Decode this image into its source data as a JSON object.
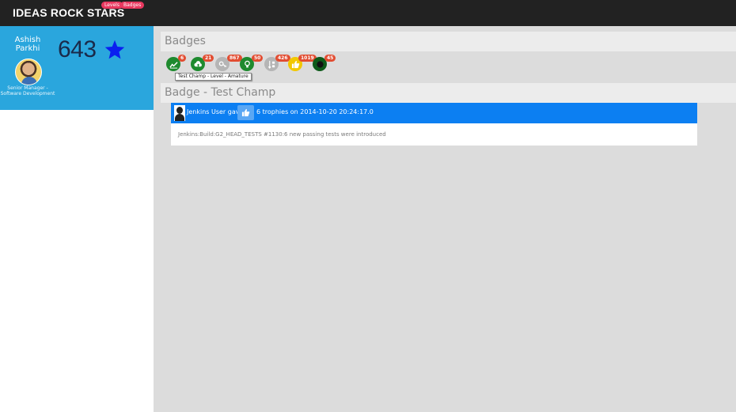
{
  "header": {
    "brand": "IDEAS ROCK STARS",
    "nav": {
      "levels": "Levels",
      "badges": "Badges"
    }
  },
  "profile": {
    "name": "Ashish Parkhi",
    "title": "Senior Manager - Software Development",
    "points": "643",
    "points_icon": "star-icon"
  },
  "badges_section": {
    "heading": "Badges",
    "items": [
      {
        "icon": "trend-chart-icon",
        "count": "6",
        "color": "#1e8a2e"
      },
      {
        "icon": "cloud-upload-icon",
        "count": "21",
        "color": "#1e8a2e"
      },
      {
        "icon": "key-icon",
        "count": "867",
        "color": "#b5b5b5"
      },
      {
        "icon": "lightbulb-icon",
        "count": "50",
        "color": "#1e8a2e"
      },
      {
        "icon": "sort-icon",
        "count": "426",
        "color": "#b5b5b5"
      },
      {
        "icon": "thumbs-up-icon",
        "count": "1019",
        "color": "#f2c800"
      },
      {
        "icon": "circle-icon",
        "count": "45",
        "color": "#0e5a1a"
      }
    ],
    "tooltip": "Test Champ - Level - Amature"
  },
  "badge_detail": {
    "heading": "Badge - Test Champ",
    "activity": {
      "giver": "Jenkins User gave",
      "action_icon": "thumbs-up-icon",
      "summary": "6 trophies on 2014-10-20 20:24:17.0",
      "detail": "Jenkins:Build:G2_HEAD_TESTS #1130:6 new passing tests were introduced"
    }
  },
  "colors": {
    "header_bg": "#222222",
    "profile_bg": "#2aa6dd",
    "activity_bg": "#0c7ff2",
    "count_badge": "#e24d32",
    "nav_pill": "#e8385f"
  }
}
